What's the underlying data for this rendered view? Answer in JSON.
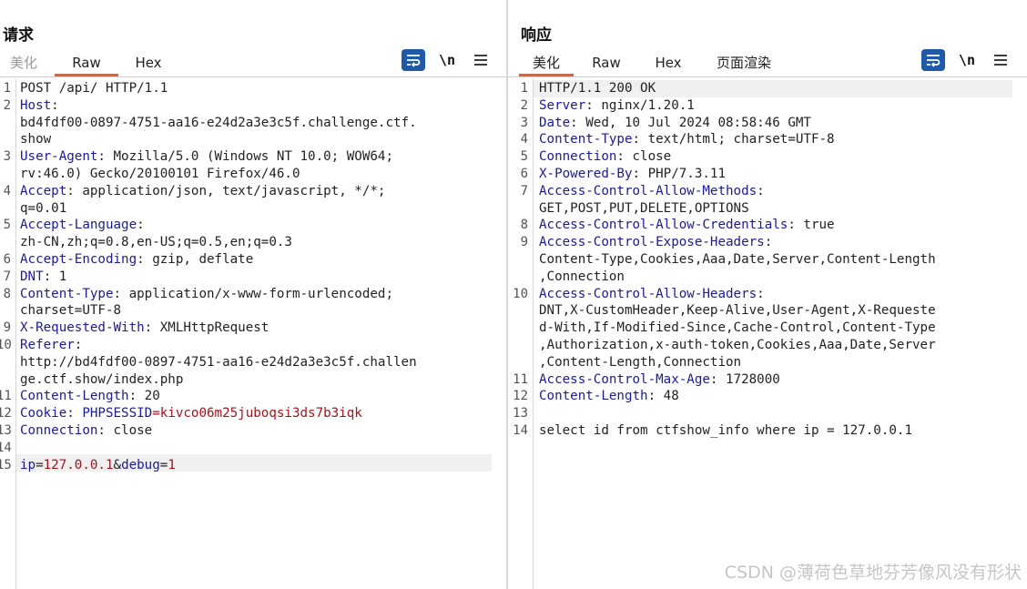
{
  "request": {
    "title": "请求",
    "tabs": [
      {
        "label": "美化",
        "state": "disabled"
      },
      {
        "label": "Raw",
        "state": "active"
      },
      {
        "label": "Hex",
        "state": "normal"
      }
    ],
    "tools": {
      "wrap_icon": "wrap-lines-icon",
      "newline_label": "\\n",
      "menu_icon": "hamburger-menu-icon"
    },
    "lines": [
      {
        "n": "1",
        "c": "POST /api/ HTTP/1.1"
      },
      {
        "n": "2",
        "k": "Host",
        "v": ":"
      },
      {
        "n": "",
        "c": "bd4fdf00-0897-4751-aa16-e24d2a3e3c5f.challenge.ctf."
      },
      {
        "n": "",
        "c": "show"
      },
      {
        "n": "3",
        "k": "User-Agent",
        "v": ": Mozilla/5.0 (Windows NT 10.0; WOW64;"
      },
      {
        "n": "",
        "c": "rv:46.0) Gecko/20100101 Firefox/46.0"
      },
      {
        "n": "4",
        "k": "Accept",
        "v": ": application/json, text/javascript, */*;"
      },
      {
        "n": "",
        "c": "q=0.01"
      },
      {
        "n": "5",
        "k": "Accept-Language",
        "v": ":"
      },
      {
        "n": "",
        "c": "zh-CN,zh;q=0.8,en-US;q=0.5,en;q=0.3"
      },
      {
        "n": "6",
        "k": "Accept-Encoding",
        "v": ": gzip, deflate"
      },
      {
        "n": "7",
        "k": "DNT",
        "v": ": 1"
      },
      {
        "n": "8",
        "k": "Content-Type",
        "v": ": application/x-www-form-urlencoded;"
      },
      {
        "n": "",
        "c": "charset=UTF-8"
      },
      {
        "n": "9",
        "k": "X-Requested-With",
        "v": ": XMLHttpRequest"
      },
      {
        "n": "10",
        "k": "Referer",
        "v": ":"
      },
      {
        "n": "",
        "c": "http://bd4fdf00-0897-4751-aa16-e24d2a3e3c5f.challen"
      },
      {
        "n": "",
        "c": "ge.ctf.show/index.php"
      },
      {
        "n": "11",
        "k": "Content-Length",
        "v": ": 20"
      },
      {
        "n": "12",
        "k": "Cookie",
        "v": ": ",
        "ck": "PHPSESSID",
        "cv": "=kivco06m25juboqsi3ds7b3iqk"
      },
      {
        "n": "13",
        "k": "Connection",
        "v": ": close"
      },
      {
        "n": "14",
        "c": ""
      },
      {
        "n": "15",
        "body": true,
        "p1": "ip",
        "eq1": "=",
        "v1": "127.0.0.1",
        "amp": "&",
        "p2": "debug",
        "eq2": "=",
        "v2": "1"
      }
    ]
  },
  "response": {
    "title": "响应",
    "tabs": [
      {
        "label": "美化",
        "state": "active"
      },
      {
        "label": "Raw",
        "state": "normal"
      },
      {
        "label": "Hex",
        "state": "normal"
      },
      {
        "label": "页面渲染",
        "state": "normal"
      }
    ],
    "tools": {
      "wrap_icon": "wrap-lines-icon",
      "newline_label": "\\n",
      "menu_icon": "hamburger-menu-icon"
    },
    "lines": [
      {
        "n": "1",
        "c": "HTTP/1.1 200 OK"
      },
      {
        "n": "2",
        "k": "Server",
        "v": ": nginx/1.20.1"
      },
      {
        "n": "3",
        "k": "Date",
        "v": ": Wed, 10 Jul 2024 08:58:46 GMT"
      },
      {
        "n": "4",
        "k": "Content-Type",
        "v": ": text/html; charset=UTF-8"
      },
      {
        "n": "5",
        "k": "Connection",
        "v": ": close"
      },
      {
        "n": "6",
        "k": "X-Powered-By",
        "v": ": PHP/7.3.11"
      },
      {
        "n": "7",
        "k": "Access-Control-Allow-Methods",
        "v": ":"
      },
      {
        "n": "",
        "c": "GET,POST,PUT,DELETE,OPTIONS"
      },
      {
        "n": "8",
        "k": "Access-Control-Allow-Credentials",
        "v": ": true"
      },
      {
        "n": "9",
        "k": "Access-Control-Expose-Headers",
        "v": ":"
      },
      {
        "n": "",
        "c": "Content-Type,Cookies,Aaa,Date,Server,Content-Length"
      },
      {
        "n": "",
        "c": ",Connection"
      },
      {
        "n": "10",
        "k": "Access-Control-Allow-Headers",
        "v": ":"
      },
      {
        "n": "",
        "c": "DNT,X-CustomHeader,Keep-Alive,User-Agent,X-Requeste"
      },
      {
        "n": "",
        "c": "d-With,If-Modified-Since,Cache-Control,Content-Type"
      },
      {
        "n": "",
        "c": ",Authorization,x-auth-token,Cookies,Aaa,Date,Server"
      },
      {
        "n": "",
        "c": ",Content-Length,Connection"
      },
      {
        "n": "11",
        "k": "Access-Control-Max-Age",
        "v": ": 1728000"
      },
      {
        "n": "12",
        "k": "Content-Length",
        "v": ": 48"
      },
      {
        "n": "13",
        "c": ""
      },
      {
        "n": "14",
        "c": "select id from ctfshow_info where ip = 127.0.0.1"
      }
    ]
  },
  "layout_buttons": [
    {
      "icon": "split-columns-icon",
      "state": "active"
    },
    {
      "icon": "split-rows-icon",
      "state": "normal"
    },
    {
      "icon": "single-pane-icon",
      "state": "normal"
    }
  ],
  "watermark": "CSDN @薄荷色草地芬芳像风没有形状",
  "colors": {
    "accent_blue": "#1f5aa8",
    "tab_underline": "#e8602c",
    "header_key": "#1a1a9c",
    "value_red": "#a3141c"
  }
}
